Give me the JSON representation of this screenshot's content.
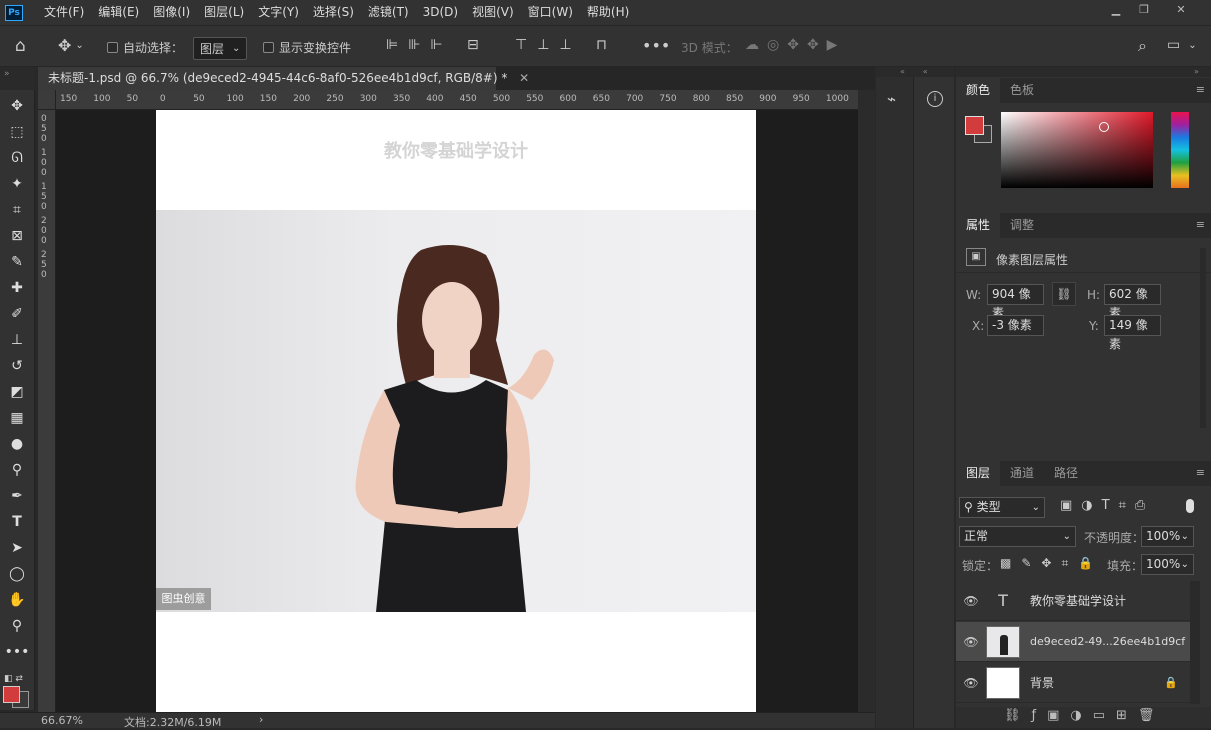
{
  "app": {
    "logo": "Ps"
  },
  "menu": [
    "文件(F)",
    "编辑(E)",
    "图像(I)",
    "图层(L)",
    "文字(Y)",
    "选择(S)",
    "滤镜(T)",
    "3D(D)",
    "视图(V)",
    "窗口(W)",
    "帮助(H)"
  ],
  "options": {
    "auto_select_label": "自动选择：",
    "auto_select_target": "图层",
    "show_transform_label": "显示变换控件",
    "mode3d_label": "3D 模式："
  },
  "document": {
    "tab_title": "未标题-1.psd @ 66.7% (de9eced2-4945-44c6-8af0-526ee4b1d9cf, RGB/8#) *",
    "canvas_heading": "教你零基础学设计",
    "watermark": "图虫创意"
  },
  "ruler": {
    "h_ticks": [
      "150",
      "100",
      "50",
      "0",
      "50",
      "100",
      "150",
      "200",
      "250",
      "300",
      "350",
      "400",
      "450",
      "500",
      "550",
      "600",
      "650",
      "700",
      "750",
      "800",
      "850",
      "900",
      "950",
      "1000"
    ],
    "v_ticks": [
      "0",
      "5",
      "0",
      "1",
      "0",
      "0",
      "1",
      "5",
      "0",
      "2",
      "0",
      "0",
      "2",
      "5",
      "0"
    ]
  },
  "status": {
    "zoom": "66.67%",
    "doc_size": "文档:2.32M/6.19M"
  },
  "color_panel": {
    "tabs": [
      "颜色",
      "色板"
    ],
    "fg_color": "#d23c3c",
    "bg_color": "#3a3a3a"
  },
  "properties_panel": {
    "tabs": [
      "属性",
      "调整"
    ],
    "type_label": "像素图层属性",
    "w_label": "W:",
    "w_value": "904 像素",
    "h_label": "H:",
    "h_value": "602 像素",
    "x_label": "X:",
    "x_value": "-3 像素",
    "y_label": "Y:",
    "y_value": "149 像素"
  },
  "layers_panel": {
    "tabs": [
      "图层",
      "通道",
      "路径"
    ],
    "filter_kind": "类型",
    "blend_mode": "正常",
    "opacity_label": "不透明度：",
    "opacity_value": "100%",
    "lock_label": "锁定：",
    "fill_label": "填充：",
    "fill_value": "100%",
    "layers": [
      {
        "name": "教你零基础学设计",
        "kind": "text"
      },
      {
        "name": "de9eced2-49...26ee4b1d9cf",
        "kind": "image"
      },
      {
        "name": "背景",
        "kind": "background"
      }
    ]
  }
}
